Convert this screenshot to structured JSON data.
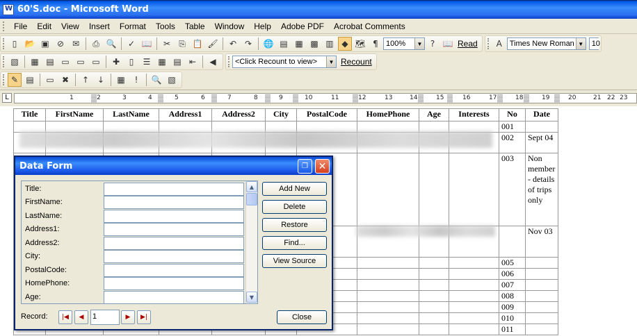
{
  "window": {
    "title": "60'S.doc - Microsoft Word"
  },
  "menu": [
    "File",
    "Edit",
    "View",
    "Insert",
    "Format",
    "Tools",
    "Table",
    "Window",
    "Help",
    "Adobe PDF",
    "Acrobat Comments"
  ],
  "toolbar": {
    "zoom": "100%",
    "read_label": "Read",
    "font_name": "Times New Roman",
    "font_size": "10",
    "recount_placeholder": "<Click Recount to view>",
    "recount_label": "Recount"
  },
  "ruler": {
    "numbers": [
      "1",
      "2",
      "3",
      "4",
      "5",
      "6",
      "7",
      "8",
      "9",
      "10",
      "11",
      "12",
      "13",
      "14",
      "15",
      "16",
      "17",
      "18",
      "19",
      "20",
      "21",
      "22",
      "23"
    ]
  },
  "document": {
    "headers": [
      "Title",
      "FirstName",
      "LastName",
      "Address1",
      "Address2",
      "City",
      "PostalCode",
      "HomePhone",
      "Age",
      "Interests",
      "No",
      "Date"
    ],
    "rows": [
      {
        "no": "001",
        "date": ""
      },
      {
        "no": "002",
        "date": "Sept 04"
      },
      {
        "no": "003",
        "date": "Non member - details of trips only"
      },
      {
        "no": "",
        "date": "Nov 03"
      },
      {
        "no": "005",
        "date": ""
      },
      {
        "no": "006",
        "date": ""
      },
      {
        "no": "007",
        "date": ""
      },
      {
        "no": "008",
        "date": ""
      },
      {
        "no": "009",
        "date": ""
      },
      {
        "no": "010",
        "date": ""
      },
      {
        "no": "011",
        "date": ""
      }
    ]
  },
  "dialog": {
    "title": "Data Form",
    "fields": [
      {
        "label": "Title:",
        "value": ""
      },
      {
        "label": "FirstName:",
        "value": ""
      },
      {
        "label": "LastName:",
        "value": ""
      },
      {
        "label": "Address1:",
        "value": ""
      },
      {
        "label": "Address2:",
        "value": ""
      },
      {
        "label": "City:",
        "value": ""
      },
      {
        "label": "PostalCode:",
        "value": ""
      },
      {
        "label": "HomePhone:",
        "value": ""
      },
      {
        "label": "Age:",
        "value": ""
      }
    ],
    "buttons": {
      "add_new": "Add New",
      "delete": "Delete",
      "restore": "Restore",
      "find": "Find...",
      "view_source": "View Source",
      "close": "Close"
    },
    "record_label": "Record:",
    "record_value": "1"
  }
}
